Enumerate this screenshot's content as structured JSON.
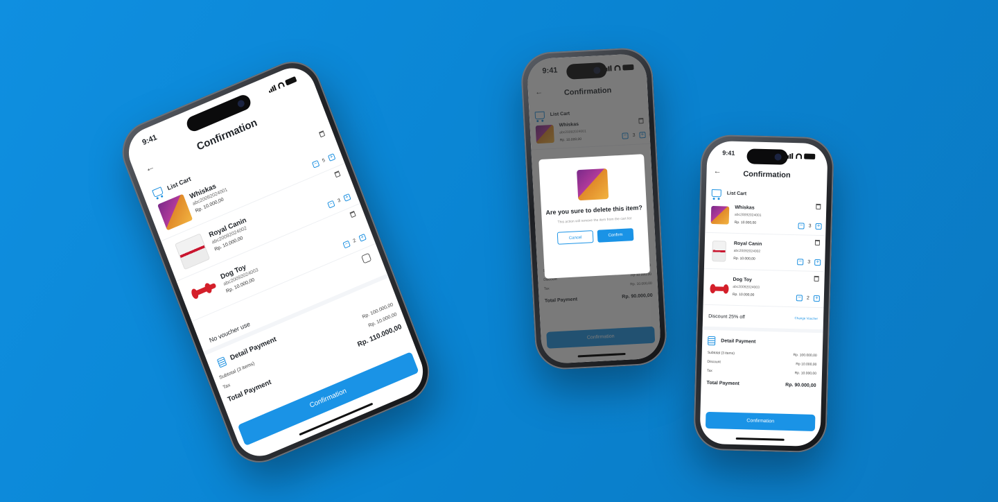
{
  "status_time": "9:41",
  "header": {
    "title": "Confirmation",
    "back_icon": "arrow-left-icon"
  },
  "cart": {
    "heading": "List Cart",
    "items": [
      {
        "name": "Whiskas",
        "code": "abc20092024001",
        "price": "Rp. 10.000,00",
        "qty_p1": "5",
        "qty_p2": "3",
        "qty_p3": "3"
      },
      {
        "name": "Royal Canin",
        "code": "abc20092024002",
        "price": "Rp. 10.000,00",
        "qty": "3"
      },
      {
        "name": "Dog Toy",
        "code": "abc20092024003",
        "price": "Rp. 10.000,00",
        "qty": "2"
      }
    ]
  },
  "voucher": {
    "none_label": "No voucher use",
    "applied_label": "Discount 25% off",
    "change_label": "Change Voucher"
  },
  "payment": {
    "heading": "Detail Payment",
    "subtotal_label": "Subtotal (3 items)",
    "subtotal_value": "Rp. 100.000,00",
    "discount_label": "Discount",
    "discount_value": "Rp 10.000,00",
    "tax_label": "Tax",
    "tax_value": "Rp. 10.000,00",
    "total_label": "Total Payment",
    "total_value_p1": "Rp. 110.000,00",
    "total_value_p3": "Rp. 90.000,00"
  },
  "cta_label": "Confirmation",
  "dialog": {
    "question": "Are you sure to delete this item?",
    "subtext": "This action will remove the item from the cart list",
    "cancel_label": "Cancel",
    "confirm_label": "Confirm"
  },
  "colors": {
    "background": "#0b86d4",
    "accent": "#1a93e6"
  }
}
